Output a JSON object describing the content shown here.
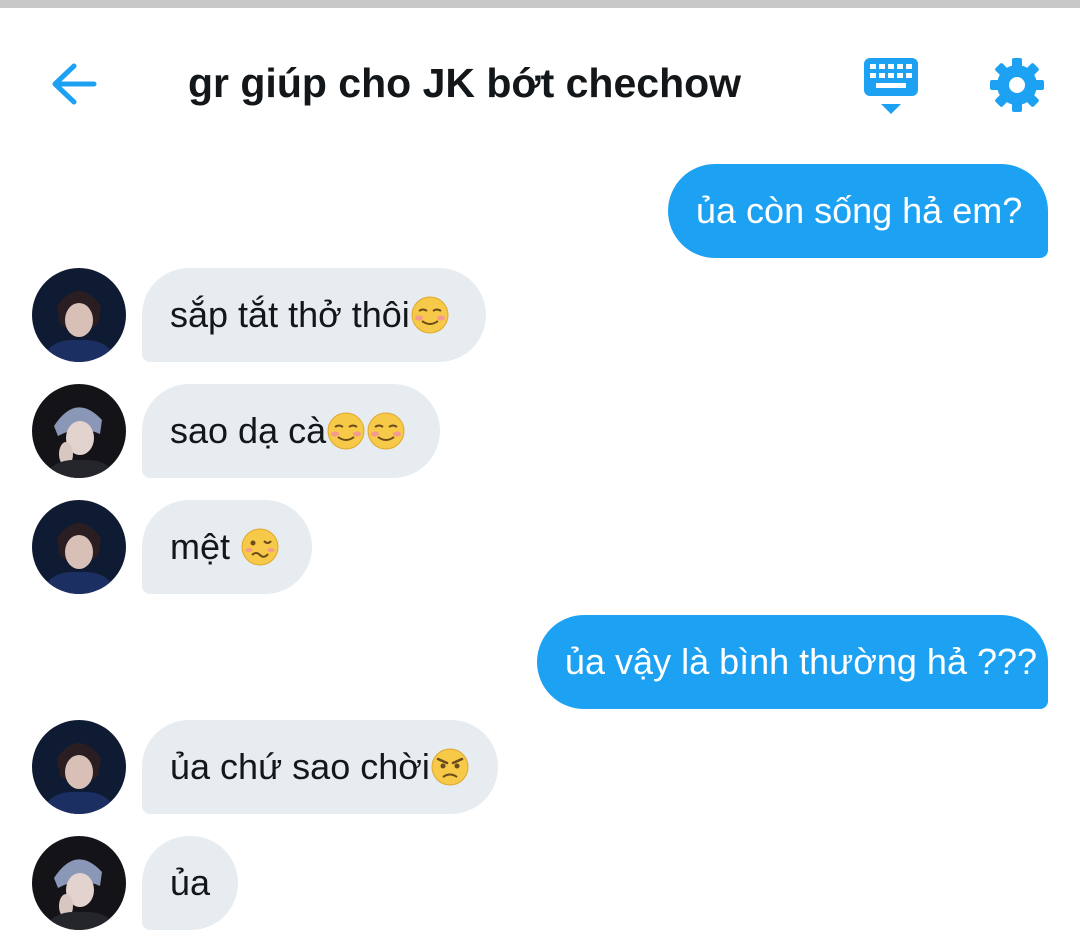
{
  "header": {
    "title": "gr giúp cho JK bớt chechow",
    "back_icon": "arrow-left-icon",
    "keyboard_icon": "keyboard-icon",
    "settings_icon": "gear-icon",
    "accent": "#1da1f2"
  },
  "colors": {
    "outgoing_bubble": "#1da1f2",
    "incoming_bubble": "#e6ecf0",
    "text_dark": "#14171a"
  },
  "messages": [
    {
      "direction": "out",
      "text": "ủa còn sống hả em?"
    },
    {
      "direction": "in",
      "sender": "avatar-a",
      "text": "sắp tắt thở thôi",
      "emojis": [
        "smiling-face-icon"
      ]
    },
    {
      "direction": "in",
      "sender": "avatar-b",
      "text": "sao dạ cà",
      "emojis": [
        "smiling-face-icon",
        "smiling-face-icon"
      ]
    },
    {
      "direction": "in",
      "sender": "avatar-a",
      "text": "mệt ",
      "emojis": [
        "woozy-face-icon"
      ]
    },
    {
      "direction": "out",
      "text": "ủa vậy là bình thường hả ???"
    },
    {
      "direction": "in",
      "sender": "avatar-a",
      "text": "ủa chứ sao chời",
      "emojis": [
        "angry-face-icon"
      ]
    },
    {
      "direction": "in",
      "sender": "avatar-b",
      "text": "ủa"
    }
  ]
}
